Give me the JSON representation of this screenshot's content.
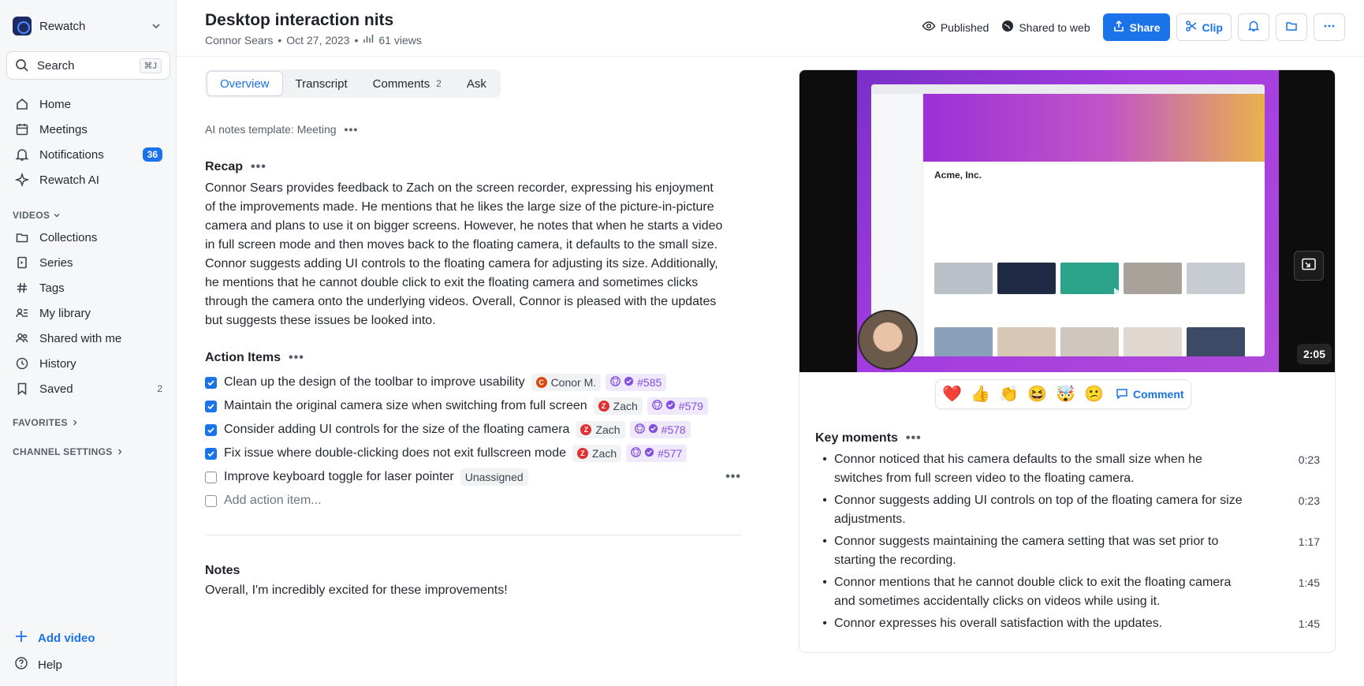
{
  "sidebar": {
    "workspace": "Rewatch",
    "search": {
      "label": "Search",
      "shortcut": "⌘J"
    },
    "nav": [
      {
        "label": "Home",
        "icon": "home-icon"
      },
      {
        "label": "Meetings",
        "icon": "calendar-icon"
      },
      {
        "label": "Notifications",
        "icon": "bell-icon",
        "badge": "36"
      },
      {
        "label": "Rewatch AI",
        "icon": "sparkle-icon"
      }
    ],
    "videos_header": "VIDEOS",
    "videos": [
      {
        "label": "Collections",
        "icon": "folder-icon"
      },
      {
        "label": "Series",
        "icon": "series-icon"
      },
      {
        "label": "Tags",
        "icon": "hash-icon"
      },
      {
        "label": "My library",
        "icon": "library-icon"
      },
      {
        "label": "Shared with me",
        "icon": "users-icon"
      },
      {
        "label": "History",
        "icon": "history-icon"
      },
      {
        "label": "Saved",
        "icon": "bookmark-icon",
        "count": "2"
      }
    ],
    "favorites": "FAVORITES",
    "channel_settings": "CHANNEL SETTINGS",
    "add_video": "Add video",
    "help": "Help"
  },
  "header": {
    "title": "Desktop interaction nits",
    "author": "Connor Sears",
    "date": "Oct 27, 2023",
    "views": "61 views",
    "published": "Published",
    "shared": "Shared to web",
    "share_btn": "Share",
    "clip_btn": "Clip"
  },
  "tabs": [
    {
      "label": "Overview"
    },
    {
      "label": "Transcript"
    },
    {
      "label": "Comments",
      "count": "2"
    },
    {
      "label": "Ask"
    }
  ],
  "ai_template": "AI notes template: Meeting",
  "recap": {
    "title": "Recap",
    "body": "Connor Sears provides feedback to Zach on the screen recorder, expressing his enjoyment of the improvements made. He mentions that he likes the large size of the picture-in-picture camera and plans to use it on bigger screens. However, he notes that when he starts a video in full screen mode and then moves back to the floating camera, it defaults to the small size. Connor suggests adding UI controls to the floating camera for adjusting its size. Additionally, he mentions that he cannot double click to exit the floating camera and sometimes clicks through the camera onto the underlying videos. Overall, Connor is pleased with the updates but suggests these issues be looked into."
  },
  "action_items": {
    "title": "Action Items",
    "items": [
      {
        "text": "Clean up the design of the toolbar to improve usability",
        "assignee": "Conor M.",
        "avatar": "C",
        "avatar_color": "#d9480f",
        "issue": "#585"
      },
      {
        "text": "Maintain the original camera size when switching from full screen",
        "assignee": "Zach",
        "avatar": "Z",
        "avatar_color": "#e03131",
        "issue": "#579"
      },
      {
        "text": "Consider adding UI controls for the size of the floating camera",
        "assignee": "Zach",
        "avatar": "Z",
        "avatar_color": "#e03131",
        "issue": "#578"
      },
      {
        "text": "Fix issue where double-clicking does not exit fullscreen mode",
        "assignee": "Zach",
        "avatar": "Z",
        "avatar_color": "#e03131",
        "issue": "#577"
      }
    ],
    "unchecked": {
      "text": "Improve keyboard toggle for laser pointer",
      "assignee": "Unassigned"
    },
    "add_placeholder": "Add action item..."
  },
  "notes": {
    "title": "Notes",
    "body": "Overall, I'm incredibly excited for these improvements!"
  },
  "video": {
    "duration": "2:05",
    "company": "Acme, Inc."
  },
  "reactions": [
    "❤️",
    "👍",
    "👏",
    "😆",
    "🤯",
    "😕"
  ],
  "comment_btn": "Comment",
  "key_moments": {
    "title": "Key moments",
    "items": [
      {
        "text": "Connor noticed that his camera defaults to the small size when he switches from full screen video to the floating camera.",
        "time": "0:23"
      },
      {
        "text": "Connor suggests adding UI controls on top of the floating camera for size adjustments.",
        "time": "0:23"
      },
      {
        "text": "Connor suggests maintaining the camera setting that was set prior to starting the recording.",
        "time": "1:17"
      },
      {
        "text": "Connor mentions that he cannot double click to exit the floating camera and sometimes accidentally clicks on videos while using it.",
        "time": "1:45"
      },
      {
        "text": "Connor expresses his overall satisfaction with the updates.",
        "time": "1:45"
      }
    ]
  },
  "colors": {
    "accent": "#1a73e8",
    "github": "#8250df"
  }
}
